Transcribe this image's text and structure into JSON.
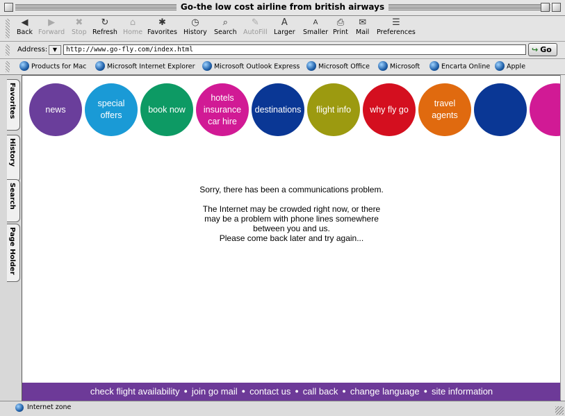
{
  "window": {
    "title": "Go-the low cost airline from british airways"
  },
  "toolbar": {
    "buttons": [
      {
        "label": "Back",
        "icon": "back-arrow-icon",
        "glyph": "◀",
        "enabled": true
      },
      {
        "label": "Forward",
        "icon": "forward-arrow-icon",
        "glyph": "▶",
        "enabled": false
      },
      {
        "label": "Stop",
        "icon": "stop-icon",
        "glyph": "✖",
        "enabled": false
      },
      {
        "label": "Refresh",
        "icon": "refresh-icon",
        "glyph": "↻",
        "enabled": true
      },
      {
        "label": "Home",
        "icon": "home-icon",
        "glyph": "⌂",
        "enabled": false
      },
      {
        "label": "Favorites",
        "icon": "favorites-icon",
        "glyph": "✱",
        "enabled": true
      },
      {
        "label": "History",
        "icon": "history-icon",
        "glyph": "◷",
        "enabled": true
      },
      {
        "label": "Search",
        "icon": "search-icon",
        "glyph": "⌕",
        "enabled": true
      },
      {
        "label": "AutoFill",
        "icon": "autofill-icon",
        "glyph": "✎",
        "enabled": false
      },
      {
        "label": "Larger",
        "icon": "text-larger-icon",
        "glyph": "A",
        "enabled": true
      },
      {
        "label": "Smaller",
        "icon": "text-smaller-icon",
        "glyph": "A",
        "enabled": true
      },
      {
        "label": "Print",
        "icon": "print-icon",
        "glyph": "⎙",
        "enabled": true
      },
      {
        "label": "Mail",
        "icon": "mail-icon",
        "glyph": "✉",
        "enabled": true
      },
      {
        "label": "Preferences",
        "icon": "preferences-icon",
        "glyph": "☰",
        "enabled": true
      }
    ]
  },
  "address": {
    "label": "Address:",
    "url": "http://www.go-fly.com/index.html",
    "go_label": "Go"
  },
  "links": [
    "Products for Mac",
    "Microsoft Internet Explorer",
    "Microsoft Outlook Express",
    "Microsoft Office",
    "Microsoft",
    "Encarta Online",
    "Apple"
  ],
  "sidetabs": [
    "Favorites",
    "History",
    "Search",
    "Page Holder"
  ],
  "nav_circles": [
    {
      "lines": [
        "news"
      ],
      "color": "purple"
    },
    {
      "lines": [
        "special",
        "offers"
      ],
      "color": "cyan"
    },
    {
      "lines": [
        "book now"
      ],
      "color": "green"
    },
    {
      "lines": [
        "hotels",
        "insurance",
        "car hire"
      ],
      "color": "magenta"
    },
    {
      "lines": [
        "destinations"
      ],
      "color": "navy"
    },
    {
      "lines": [
        "flight info"
      ],
      "color": "olive"
    },
    {
      "lines": [
        "why fly go"
      ],
      "color": "red"
    },
    {
      "lines": [
        "travel",
        "agents"
      ],
      "color": "orange"
    },
    {
      "lines": [],
      "color": "navy"
    },
    {
      "lines": [],
      "color": "magenta"
    }
  ],
  "error": {
    "headline": "Sorry, there has been a communications problem.",
    "details": [
      "The Internet may be crowded right now, or there",
      "may be a problem with phone lines somewhere",
      "between you and us.",
      "Please come back later and try again..."
    ]
  },
  "footer": {
    "links": [
      "check flight availability",
      "join go mail",
      "contact us",
      "call back",
      "change language",
      "site information"
    ],
    "separator": "●"
  },
  "status": {
    "text": "Internet zone"
  }
}
